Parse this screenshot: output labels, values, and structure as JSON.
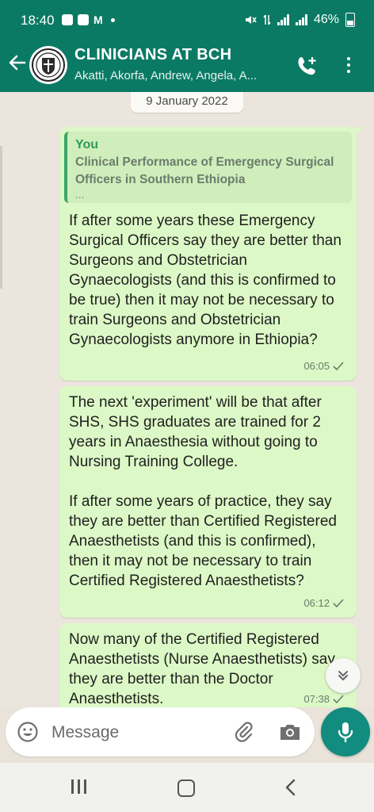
{
  "status_bar": {
    "time": "18:40",
    "battery": "46%"
  },
  "header": {
    "title": "CLINICIANS AT BCH",
    "subtitle": "Akatti, Akorfa, Andrew, Angela, A..."
  },
  "chat": {
    "date_chip": "9 January 2022",
    "messages": [
      {
        "quote_author": "You",
        "quote_text": "Clinical Performance of Emergency Surgical Officers in Southern Ethiopia",
        "quote_more": "...",
        "text": "If after some years these Emergency Surgical Officers say they are better than Surgeons and Obstetrician Gynaecologists (and this is confirmed to be true) then it may not be necessary to train Surgeons and Obstetrician Gynaecologists anymore in Ethiopia?",
        "time": "06:05"
      },
      {
        "text": "The next 'experiment' will be that after SHS, SHS graduates are trained for 2 years in Anaesthesia without going to Nursing Training College.\n\nIf after some years of practice, they say they are better than Certified Registered Anaesthetists (and this is confirmed), then it may not be necessary to train Certified Registered Anaesthetists?",
        "time": "06:12"
      },
      {
        "text": "Now many of the Certified Registered Anaesthetists (Nurse Anaesthetists) say they are better than the Doctor Anaesthetists.",
        "time": "07:38"
      }
    ]
  },
  "composer": {
    "placeholder": "Message"
  },
  "colors": {
    "header_green": "#0b7a64",
    "outgoing_bubble": "#dcf8c6",
    "mic_button": "#128c7e",
    "tick_gray": "#6b7b6b"
  }
}
